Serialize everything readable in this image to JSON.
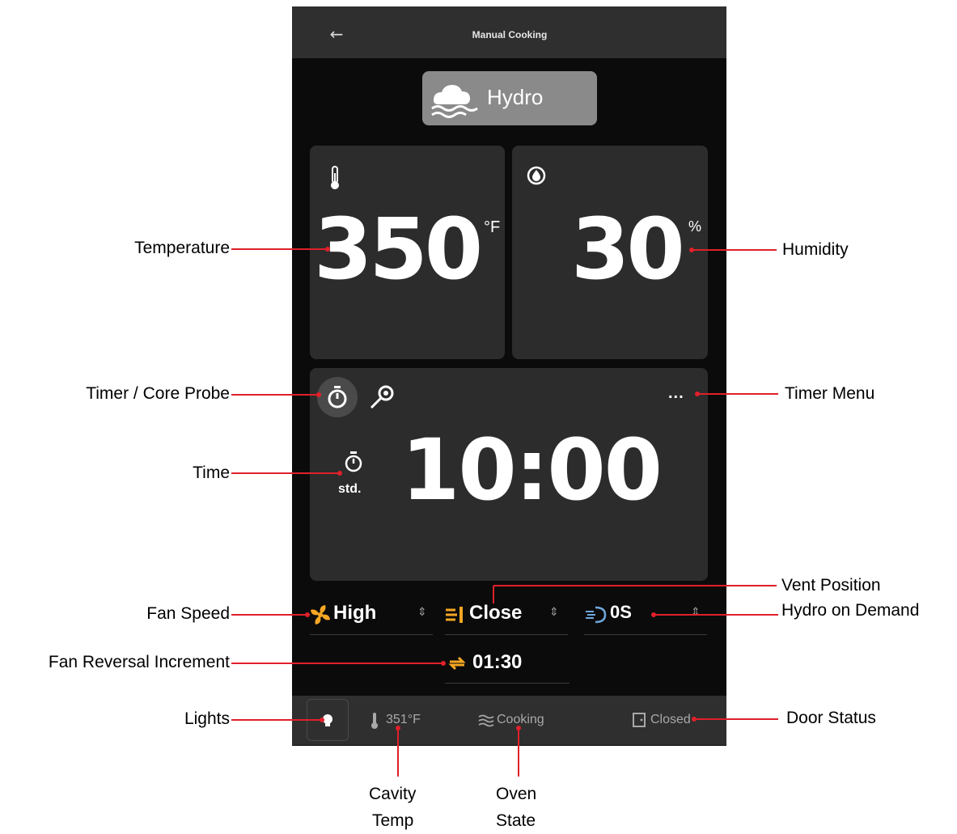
{
  "header": {
    "back_icon": "arrow-left-icon",
    "title": "Manual Cooking"
  },
  "mode": {
    "label": "Hydro",
    "icon": "hydro-steam-icon"
  },
  "temperature": {
    "value": "350",
    "unit": "°F",
    "icon": "thermometer-icon"
  },
  "humidity": {
    "value": "30",
    "unit": "%",
    "icon": "humidity-icon"
  },
  "timer": {
    "tabs": [
      {
        "name": "timer",
        "icon": "stopwatch-icon",
        "active": true
      },
      {
        "name": "core-probe",
        "icon": "probe-icon",
        "active": false
      }
    ],
    "menu_label": "...",
    "mode_label": "std.",
    "value": "10:00"
  },
  "controls": {
    "fan_speed": {
      "label": "High",
      "icon": "fan-icon"
    },
    "vent": {
      "label": "Close",
      "icon": "vent-icon"
    },
    "hydro_on_demand": {
      "label": "0S",
      "icon": "hydro-demand-icon"
    },
    "fan_reversal": {
      "label": "01:30",
      "icon": "fan-reversal-icon"
    }
  },
  "status": {
    "lights_icon": "bulb-icon",
    "cavity_temp": "351°F",
    "oven_state": "Cooking",
    "door": "Closed"
  },
  "callouts": {
    "temperature": "Temperature",
    "humidity": "Humidity",
    "timer_probe": "Timer / Core Probe",
    "timer_menu": "Timer Menu",
    "time": "Time",
    "vent_position": "Vent Position",
    "hydro_on_demand": "Hydro on Demand",
    "fan_speed": "Fan Speed",
    "fan_reversal": "Fan Reversal Increment",
    "lights": "Lights",
    "door_status": "Door Status",
    "cavity_temp_1": "Cavity",
    "cavity_temp_2": "Temp",
    "oven_state_1": "Oven",
    "oven_state_2": "State"
  },
  "colors": {
    "accent": "#f5a623",
    "hydro_blue": "#6fa8dc",
    "callout_line": "#e0202a",
    "card": "#2c2c2c",
    "bar": "#2f2f2f"
  }
}
